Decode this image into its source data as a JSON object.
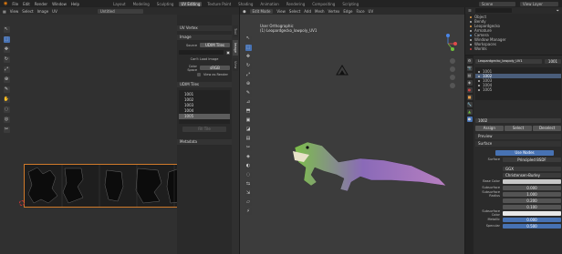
{
  "topbar": {
    "menus": [
      "File",
      "Edit",
      "Render",
      "Window",
      "Help"
    ],
    "workspaces": [
      "Layout",
      "Modeling",
      "Sculpting",
      "UV Editing",
      "Texture Paint",
      "Shading",
      "Animation",
      "Rendering",
      "Compositing",
      "Scripting"
    ],
    "active_workspace": "UV Editing",
    "scene_label": "Scene",
    "view_layer_label": "View Layer"
  },
  "uv_editor": {
    "header_items": [
      "View",
      "Select",
      "Image",
      "UV"
    ],
    "image_name": "Untitled",
    "panel_header": "UV Vertex",
    "image_header": "Image",
    "source_label": "Source",
    "source_value": "UDIM Tiles",
    "close_image_label": "Can't Load Image",
    "color_space_label": "Color Space",
    "color_space_value": "sRGB",
    "view_as_render_label": "View as Render",
    "udim_tiles_header": "UDIM Tiles",
    "tiles": [
      "1001",
      "1002",
      "1003",
      "1004",
      "1005"
    ],
    "selected_tile": "1005",
    "fill_tile_label": "Fill Tile",
    "metadata_label": "Metadata",
    "side_tabs": [
      "Tool",
      "Image",
      "View"
    ],
    "active_side_tab": "Image"
  },
  "viewport": {
    "header_items": [
      "Edit Mode",
      "View",
      "Select",
      "Add",
      "Mesh",
      "Vertex",
      "Edge",
      "Face",
      "UV"
    ],
    "mode": "Edit Mode",
    "view_name": "User Orthographic",
    "object_name": "(1) Leopardgecko_lowpoly_UV1",
    "side_tabs": [
      "Item",
      "Tool",
      "View"
    ],
    "gizmo_colors": {
      "x": "#e04b4b",
      "y": "#6fbf3c",
      "z": "#4a86e8"
    }
  },
  "outliner": {
    "items": [
      "Object",
      "Bendy",
      "Leopardgecko",
      "Armature",
      "Camera",
      "Window Manager",
      "Workspaces",
      "Worlds"
    ]
  },
  "properties": {
    "object_field": "Leopardgecko_lowpoly_UV1",
    "data_tabs": [
      "1001"
    ],
    "uv_maps": [
      "1001",
      "1002",
      "1003",
      "1004",
      "1005"
    ],
    "selected_uv": "1002",
    "material_name": "1002",
    "buttons": [
      "Assign",
      "Select",
      "Deselect"
    ],
    "preview_label": "Preview",
    "surface_label": "Surface",
    "use_nodes_label": "Use Nodes",
    "surface_field_label": "Surface",
    "surface_value": "Principled BSDF",
    "subsurface_method": "GGX",
    "subsurface_method2": "Christensen-Burley",
    "props": [
      {
        "label": "Base Color",
        "value": ""
      },
      {
        "label": "Subsurface",
        "value": "0.000"
      },
      {
        "label": "Subsurface Radius",
        "value": "1.000"
      },
      {
        "label": "",
        "value": "0.200"
      },
      {
        "label": "",
        "value": "0.100"
      },
      {
        "label": "Subsurface Color",
        "value": ""
      },
      {
        "label": "Metallic",
        "value": "0.000"
      },
      {
        "label": "Specular",
        "value": "0.500"
      }
    ]
  }
}
